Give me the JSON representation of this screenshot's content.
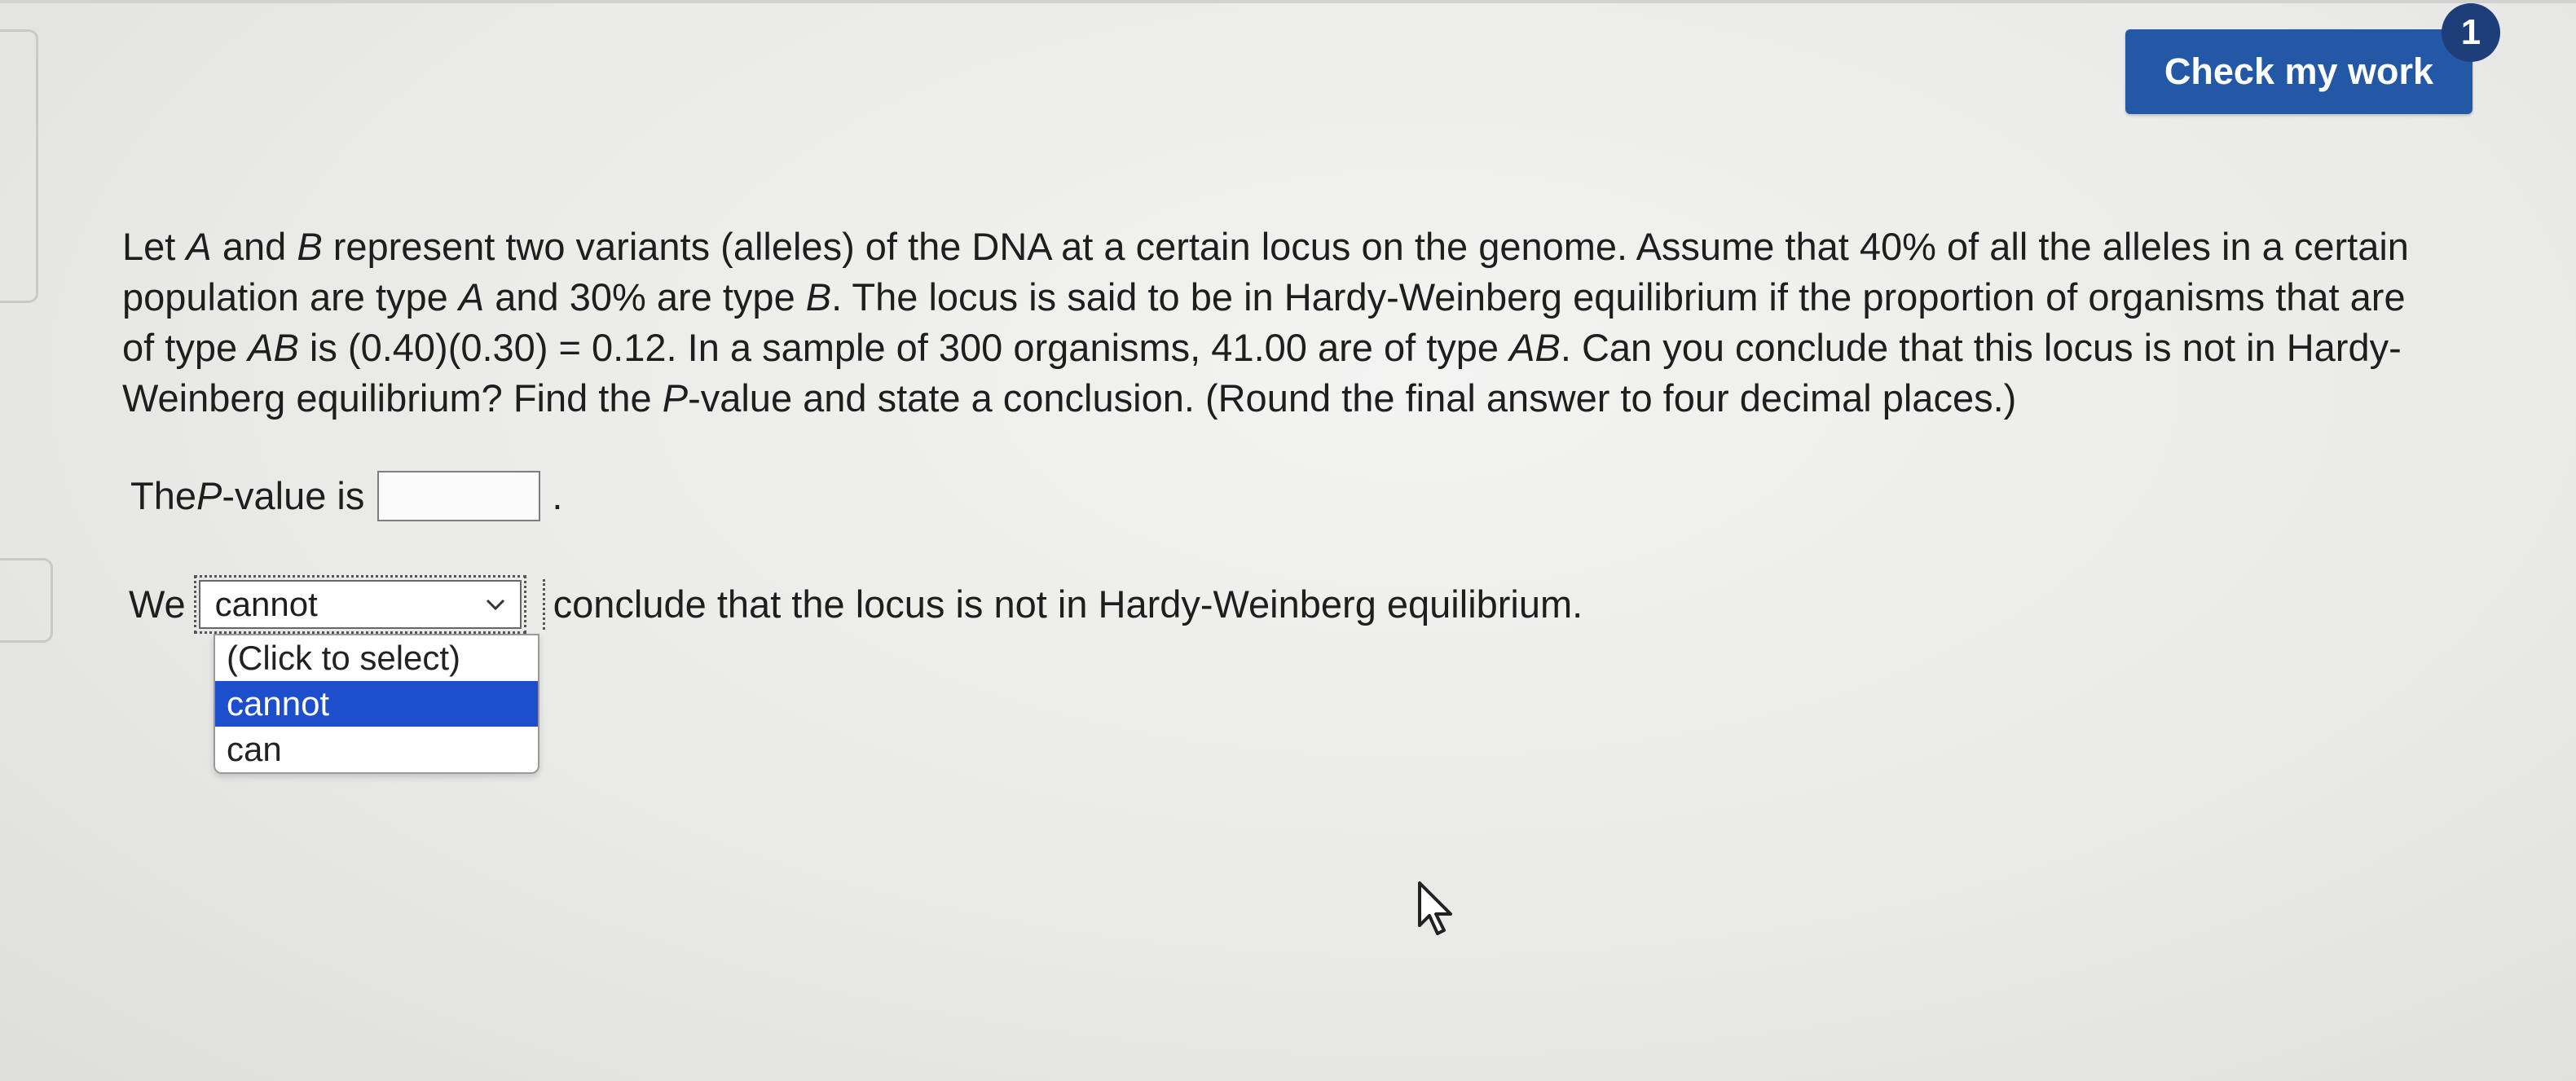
{
  "header": {
    "check_button_label": "Check my work",
    "badge_count": "1"
  },
  "question": {
    "parts": [
      "Let ",
      "A",
      " and ",
      "B",
      " represent two variants (alleles) of the DNA at a certain locus on the genome. Assume that 40% of all the alleles in a certain population are type ",
      "A",
      " and 30% are type ",
      "B",
      ". The locus is said to be in Hardy-Weinberg equilibrium if the proportion of organisms that are of type ",
      "AB",
      " is (0.40)(0.30) = 0.12. In a sample of 300 organisms, 41.00 are of type ",
      "AB",
      ". Can you conclude that this locus is not in Hardy-Weinberg equilibrium? Find the ",
      "P",
      "-value and state a conclusion. (Round the final answer to four decimal places.)"
    ]
  },
  "pvalue": {
    "label_prefix": "The ",
    "label_var": "P",
    "label_suffix": "-value is",
    "input_value": "",
    "period": "."
  },
  "conclusion": {
    "prefix": "We",
    "selected": "cannot",
    "suffix": "conclude that the locus is not in Hardy-Weinberg equilibrium.",
    "options": [
      "(Click to select)",
      "cannot",
      "can"
    ]
  }
}
